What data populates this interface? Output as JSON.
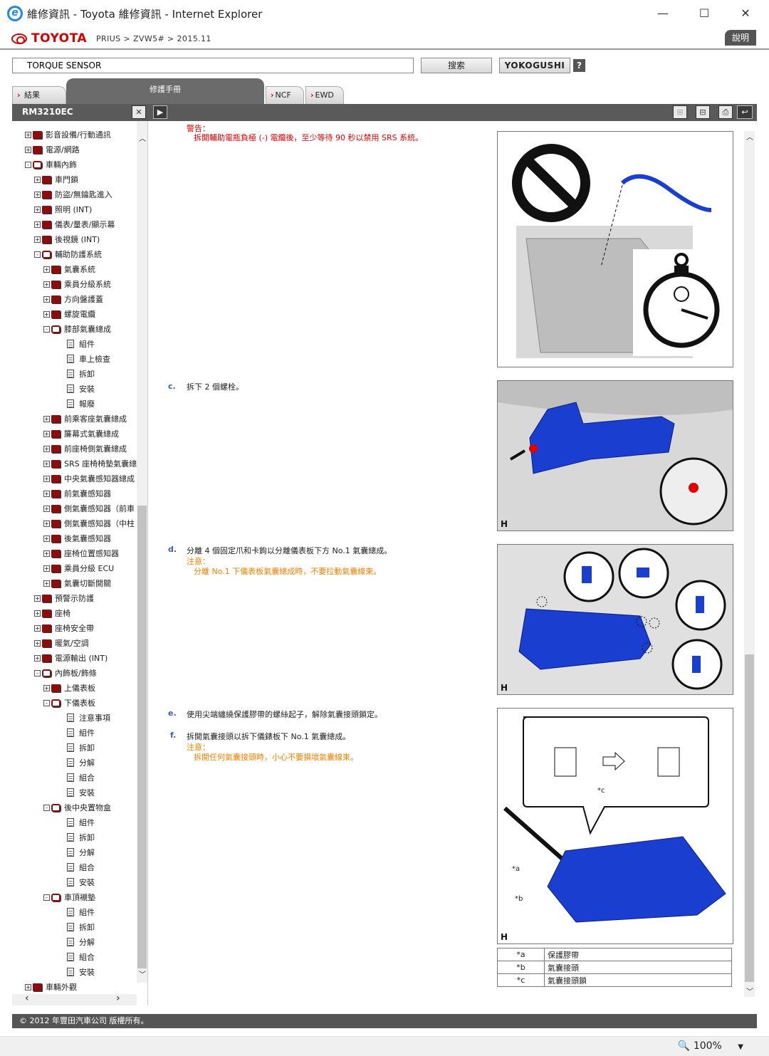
{
  "window": {
    "title": "維修資訊 - Toyota 維修資訊 - Internet Explorer"
  },
  "header": {
    "brand": "TOYOTA",
    "breadcrumb": "PRIUS > ZVW5# > 2015.11",
    "help_label": "說明"
  },
  "search": {
    "value": "TORQUE SENSOR",
    "search_label": "搜索",
    "yokogushi_label": "YOKOGUSHI",
    "help_icon": "?"
  },
  "tabs": [
    {
      "label": "結果"
    },
    {
      "label": "修護手冊"
    },
    {
      "label": "NCF"
    },
    {
      "label": "EWD"
    }
  ],
  "toolbar": {
    "doc_code": "RM3210EC"
  },
  "tree": [
    {
      "label": "影音設備/行動通訊",
      "level": 0,
      "kind": "book",
      "exp": "+"
    },
    {
      "label": "電源/網路",
      "level": 0,
      "kind": "book",
      "exp": "+"
    },
    {
      "label": "車輛內飾",
      "level": 0,
      "kind": "open",
      "exp": "-"
    },
    {
      "label": "車門鎖",
      "level": 1,
      "kind": "book",
      "exp": "+"
    },
    {
      "label": "防盜/無鑰匙進入",
      "level": 1,
      "kind": "book",
      "exp": "+"
    },
    {
      "label": "照明 (INT)",
      "level": 1,
      "kind": "book",
      "exp": "+"
    },
    {
      "label": "儀表/量表/顯示幕",
      "level": 1,
      "kind": "book",
      "exp": "+"
    },
    {
      "label": "後視鏡 (INT)",
      "level": 1,
      "kind": "book",
      "exp": "+"
    },
    {
      "label": "輔助防護系統",
      "level": 1,
      "kind": "open",
      "exp": "-"
    },
    {
      "label": "氣囊系統",
      "level": 2,
      "kind": "book",
      "exp": "+"
    },
    {
      "label": "乘員分級系統",
      "level": 2,
      "kind": "book",
      "exp": "+"
    },
    {
      "label": "方向盤護蓋",
      "level": 2,
      "kind": "book",
      "exp": "+"
    },
    {
      "label": "螺旋電纜",
      "level": 2,
      "kind": "book",
      "exp": "+"
    },
    {
      "label": "膝部氣囊總成",
      "level": 2,
      "kind": "open",
      "exp": "-"
    },
    {
      "label": "組件",
      "level": 3,
      "kind": "page",
      "exp": ""
    },
    {
      "label": "車上檢查",
      "level": 3,
      "kind": "page",
      "exp": ""
    },
    {
      "label": "拆卸",
      "level": 3,
      "kind": "page",
      "exp": ""
    },
    {
      "label": "安裝",
      "level": 3,
      "kind": "page",
      "exp": ""
    },
    {
      "label": "報廢",
      "level": 3,
      "kind": "page",
      "exp": ""
    },
    {
      "label": "前乘客座氣囊總成",
      "level": 2,
      "kind": "book",
      "exp": "+"
    },
    {
      "label": "簾幕式氣囊總成",
      "level": 2,
      "kind": "book",
      "exp": "+"
    },
    {
      "label": "前座椅側氣囊總成",
      "level": 2,
      "kind": "book",
      "exp": "+"
    },
    {
      "label": "SRS 座椅椅墊氣囊總",
      "level": 2,
      "kind": "book",
      "exp": "+"
    },
    {
      "label": "中央氣囊感知器總成",
      "level": 2,
      "kind": "book",
      "exp": "+"
    },
    {
      "label": "前氣囊感知器",
      "level": 2,
      "kind": "book",
      "exp": "+"
    },
    {
      "label": "側氣囊感知器（前車",
      "level": 2,
      "kind": "book",
      "exp": "+"
    },
    {
      "label": "側氣囊感知器（中柱",
      "level": 2,
      "kind": "book",
      "exp": "+"
    },
    {
      "label": "後氣囊感知器",
      "level": 2,
      "kind": "book",
      "exp": "+"
    },
    {
      "label": "座椅位置感知器",
      "level": 2,
      "kind": "book",
      "exp": "+"
    },
    {
      "label": "乘員分級 ECU",
      "level": 2,
      "kind": "book",
      "exp": "+"
    },
    {
      "label": "氣囊切斷開關",
      "level": 2,
      "kind": "book",
      "exp": "+"
    },
    {
      "label": "預警示防護",
      "level": 1,
      "kind": "book",
      "exp": "+"
    },
    {
      "label": "座椅",
      "level": 1,
      "kind": "book",
      "exp": "+"
    },
    {
      "label": "座椅安全帶",
      "level": 1,
      "kind": "book",
      "exp": "+"
    },
    {
      "label": "暖氣/空調",
      "level": 1,
      "kind": "book",
      "exp": "+"
    },
    {
      "label": "電源輸出 (INT)",
      "level": 1,
      "kind": "book",
      "exp": "+"
    },
    {
      "label": "內飾板/飾條",
      "level": 1,
      "kind": "open",
      "exp": "-"
    },
    {
      "label": "上儀表板",
      "level": 2,
      "kind": "book",
      "exp": "+"
    },
    {
      "label": "下儀表板",
      "level": 2,
      "kind": "open",
      "exp": "-"
    },
    {
      "label": "注意事項",
      "level": 3,
      "kind": "page",
      "exp": ""
    },
    {
      "label": "組件",
      "level": 3,
      "kind": "page",
      "exp": ""
    },
    {
      "label": "拆卸",
      "level": 3,
      "kind": "page",
      "exp": ""
    },
    {
      "label": "分解",
      "level": 3,
      "kind": "page",
      "exp": ""
    },
    {
      "label": "組合",
      "level": 3,
      "kind": "page",
      "exp": ""
    },
    {
      "label": "安裝",
      "level": 3,
      "kind": "page",
      "exp": ""
    },
    {
      "label": "後中央置物盒",
      "level": 2,
      "kind": "open",
      "exp": "-"
    },
    {
      "label": "組件",
      "level": 3,
      "kind": "page",
      "exp": ""
    },
    {
      "label": "拆卸",
      "level": 3,
      "kind": "page",
      "exp": ""
    },
    {
      "label": "分解",
      "level": 3,
      "kind": "page",
      "exp": ""
    },
    {
      "label": "組合",
      "level": 3,
      "kind": "page",
      "exp": ""
    },
    {
      "label": "安裝",
      "level": 3,
      "kind": "page",
      "exp": ""
    },
    {
      "label": "車頂襯墊",
      "level": 2,
      "kind": "open",
      "exp": "-"
    },
    {
      "label": "組件",
      "level": 3,
      "kind": "page",
      "exp": ""
    },
    {
      "label": "拆卸",
      "level": 3,
      "kind": "page",
      "exp": ""
    },
    {
      "label": "分解",
      "level": 3,
      "kind": "page",
      "exp": ""
    },
    {
      "label": "組合",
      "level": 3,
      "kind": "page",
      "exp": ""
    },
    {
      "label": "安裝",
      "level": 3,
      "kind": "page",
      "exp": ""
    },
    {
      "label": "車輛外觀",
      "level": 0,
      "kind": "book",
      "exp": "+"
    }
  ],
  "content": {
    "warning_title": "警告：",
    "warning_text": "拆開輔助電瓶負極 (-) 電纜後，至少等待 90 秒以禁用 SRS 系統。",
    "step_c_label": "c.",
    "step_c_text": "拆下 2 個螺栓。",
    "step_d_label": "d.",
    "step_d_text": "分離 4 個固定爪和卡鉤以分離儀表板下方 No.1 氣囊總成。",
    "step_d_note_title": "注意：",
    "step_d_note_text": "分離 No.1 下儀表板氣囊總成時，不要拉動氣囊線束。",
    "step_e_label": "e.",
    "step_e_text": "使用尖端纏繞保護膠帶的螺絲起子，解除氣囊接頭鎖定。",
    "step_f_label": "f.",
    "step_f_text": "拆開氣囊接頭以拆下儀錶板下 No.1 氣囊總成。",
    "step_f_note_title": "注意：",
    "step_f_note_text": "拆開任何氣囊接頭時，小心不要損壞氣囊線束。",
    "fig_mark": "H",
    "callout_a": "*a",
    "callout_b": "*b",
    "callout_c": "*c",
    "legend": [
      {
        "key": "*a",
        "value": "保護膠帶"
      },
      {
        "key": "*b",
        "value": "氣囊接頭"
      },
      {
        "key": "*c",
        "value": "氣囊接頭鎖"
      }
    ]
  },
  "footer": {
    "copyright": "© 2012 年豐田汽車公司 版權所有。"
  },
  "status": {
    "zoom": "100%"
  },
  "colors": {
    "brand_red": "#d40000",
    "warning": "#e00000",
    "note": "#f08000",
    "step_label": "#3a5fa8",
    "part_blue": "#1a3fd0"
  }
}
